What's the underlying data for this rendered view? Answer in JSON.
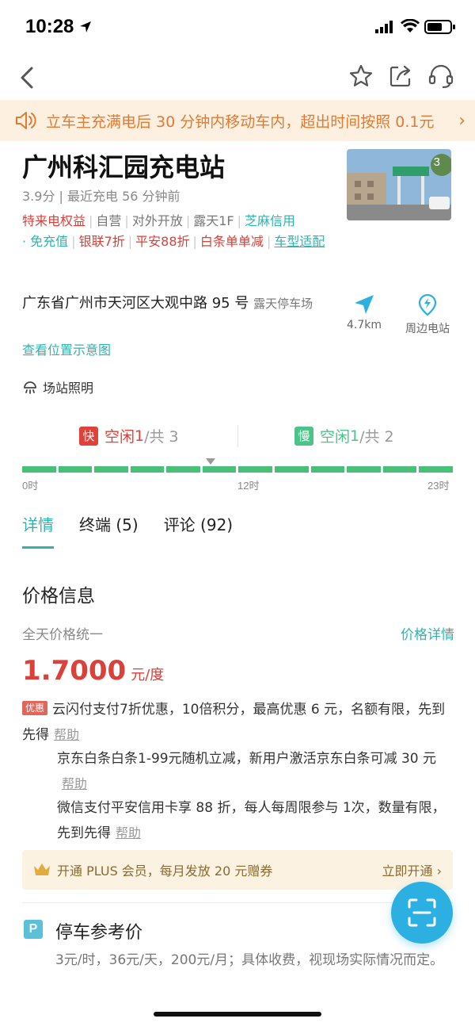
{
  "status_bar": {
    "time": "10:28"
  },
  "notice": {
    "text": "立车主充满电后 30 分钟内移动车内，超出时间按照 0.1元"
  },
  "station": {
    "name": "广州科汇园充电站",
    "meta": "3.9分 | 最近充电 56 分钟前",
    "photo_count": "3",
    "tags": {
      "t1": "特来电权益",
      "t2": "自营",
      "t3": "对外开放",
      "t4": "露天1F",
      "t5": "芝麻信用",
      "t6": "· 免充值",
      "t7": "银联7折",
      "t8": "平安88折",
      "t9": "白条单单减",
      "t10": "车型适配"
    },
    "address": "广东省广州市天河区大观中路 95 号",
    "address_note": "露天停车场",
    "map_link": "查看位置示意图",
    "distance": "4.7km",
    "nearby_label": "周边电站",
    "lighting": "场站照明"
  },
  "availability": {
    "fast_badge": "快",
    "fast_label": "空闲",
    "fast_free": "1",
    "fast_total": "/共 3",
    "slow_badge": "慢",
    "slow_label": "空闲",
    "slow_free": "1",
    "slow_total": "/共 2",
    "timeline_labels": [
      "0时",
      "12时",
      "23时"
    ]
  },
  "tabs": [
    {
      "label": "详情",
      "active": true
    },
    {
      "label": "终端 (5)",
      "active": false
    },
    {
      "label": "评论 (92)",
      "active": false
    }
  ],
  "price": {
    "section_title": "价格信息",
    "uniform": "全天价格统一",
    "detail_link": "价格详情",
    "value": "1.7000",
    "unit": "元/度"
  },
  "promotions": {
    "badge": "优惠",
    "p1": "云闪付支付7折优惠，10倍积分，最高优惠 6 元，名额有限，先到先得",
    "p2": "京东白条白条1-99元随机立减，新用户激活京东白条可减 30 元",
    "p3": "微信支付平安信用卡享 88 折，每人每周限参与 1次，数量有限，先到先得",
    "help": "帮助"
  },
  "plus": {
    "text": "开通 PLUS 会员，每月发放 20 元赠券",
    "cta": "立即开通 ›"
  },
  "parking": {
    "icon": "P",
    "title": "停车参考价",
    "text": "3元/时，36元/天，200元/月；具体收费，视现场实际情况而定。"
  },
  "colors": {
    "accent": "#2bb5b0",
    "price_red": "#d9413a",
    "fast_red": "#e0423a",
    "slow_green": "#4cc389",
    "fab_blue": "#2bb0e1"
  },
  "icons": [
    "back-arrow-icon",
    "star-icon",
    "share-icon",
    "customer-service-icon",
    "speaker-icon",
    "navigate-arrow-icon",
    "nearby-station-icon",
    "lighting-icon",
    "crown-icon",
    "scan-icon"
  ]
}
